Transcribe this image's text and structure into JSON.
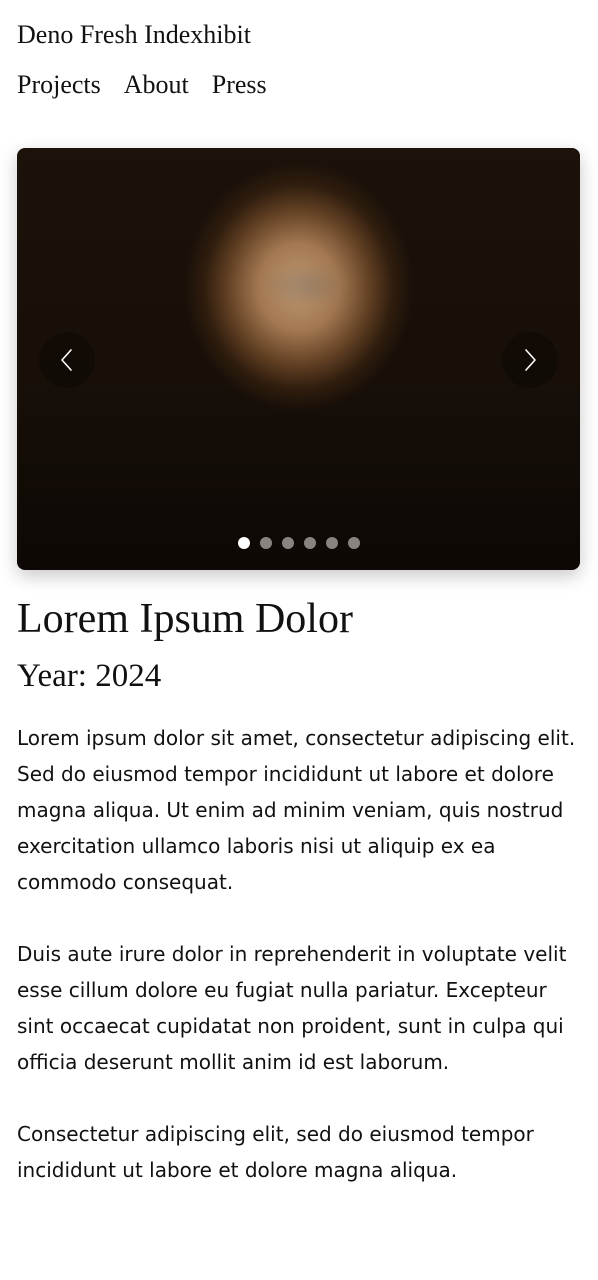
{
  "site": {
    "title": "Deno Fresh Indexhibit"
  },
  "nav": {
    "items": [
      {
        "label": "Projects"
      },
      {
        "label": "About"
      },
      {
        "label": "Press"
      }
    ]
  },
  "slider": {
    "prev_icon": "chevron-left-icon",
    "next_icon": "chevron-right-icon",
    "slide_count": 6,
    "active_index": 0
  },
  "project": {
    "title": "Lorem Ipsum Dolor",
    "year": "Year: 2024",
    "paragraphs": [
      "Lorem ipsum dolor sit amet, consectetur adipiscing elit. Sed do eiusmod tempor incididunt ut labore et dolore magna aliqua. Ut enim ad minim veniam, quis nostrud exercitation ullamco laboris nisi ut aliquip ex ea commodo consequat.",
      "Duis aute irure dolor in reprehenderit in voluptate velit esse cillum dolore eu fugiat nulla pariatur. Excepteur sint occaecat cupidatat non proident, sunt in culpa qui officia deserunt mollit anim id est laborum.",
      "Consectetur adipiscing elit, sed do eiusmod tempor incididunt ut labore et dolore magna aliqua."
    ]
  }
}
